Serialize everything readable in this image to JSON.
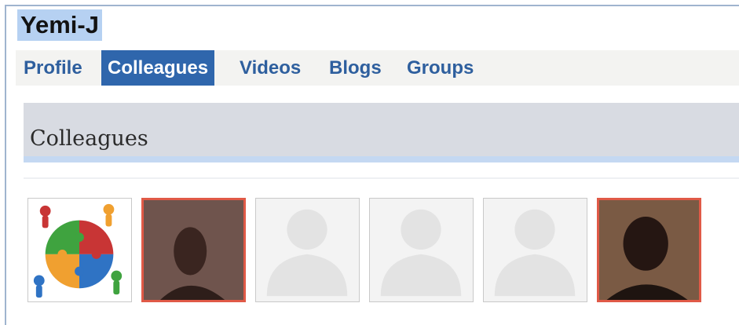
{
  "profile": {
    "username": "Yemi-J"
  },
  "tabs": [
    {
      "label": "Profile",
      "active": false
    },
    {
      "label": "Colleagues",
      "active": true
    },
    {
      "label": "Videos",
      "active": false
    },
    {
      "label": "Blogs",
      "active": false
    },
    {
      "label": "Groups",
      "active": false
    }
  ],
  "section": {
    "title": "Colleagues"
  },
  "colleagues": [
    {
      "avatar": "group-puzzle-icon"
    },
    {
      "avatar": "photo-avatar"
    },
    {
      "avatar": "default-person-icon"
    },
    {
      "avatar": "default-person-icon"
    },
    {
      "avatar": "default-person-icon"
    },
    {
      "avatar": "photo-avatar"
    }
  ],
  "colors": {
    "tab_text": "#2e5f9e",
    "tab_active_bg": "#2f66ac",
    "username_highlight": "#b6d1f2",
    "photo_frame": "#e05a47",
    "section_bg": "#d8dbe2"
  }
}
